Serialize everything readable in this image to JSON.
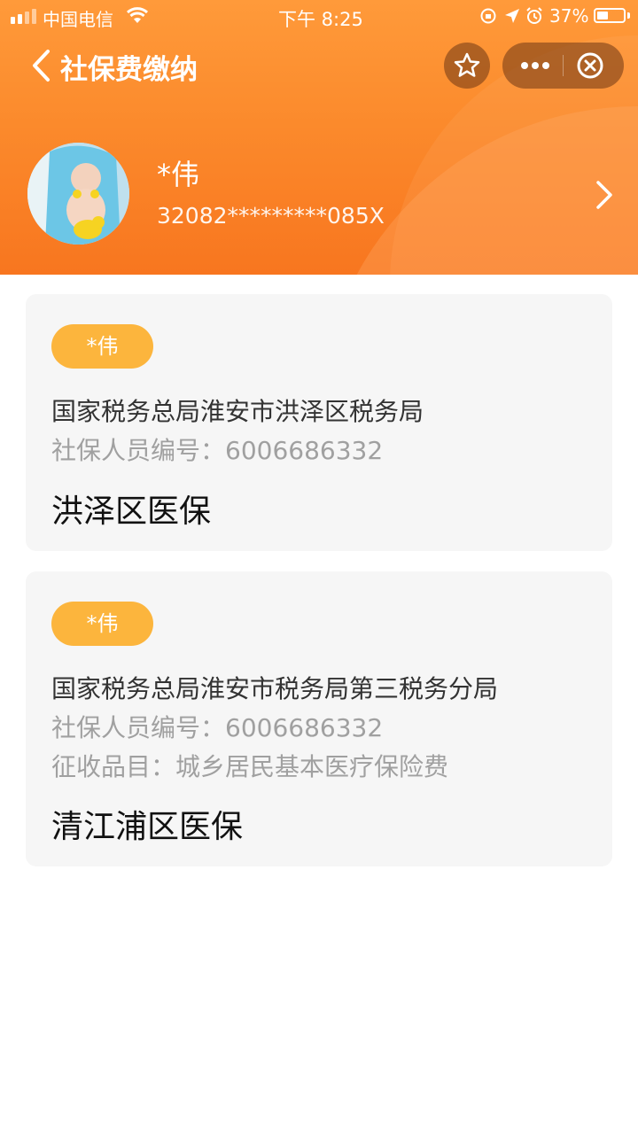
{
  "status_bar": {
    "carrier": "中国电信",
    "time": "下午 8:25",
    "battery": "37%"
  },
  "nav": {
    "title": "社保费缴纳",
    "back_icon": "chevron-left-icon",
    "favorite_icon": "star-icon",
    "more_icon": "more-dots-icon",
    "close_icon": "close-circle-icon"
  },
  "profile": {
    "name": "*伟",
    "id_number": "32082*********085X"
  },
  "cards": [
    {
      "tag": "*伟",
      "org": "国家税务总局淮安市洪泽区税务局",
      "member_id": "社保人员编号：6006686332",
      "title": "洪泽区医保"
    },
    {
      "tag": "*伟",
      "org": "国家税务总局淮安市税务局第三税务分局",
      "member_id": "社保人员编号：6006686332",
      "item": "征收品目：城乡居民基本医疗保险费",
      "title": "清江浦区医保"
    }
  ],
  "colors": {
    "header_orange": "#f8761f",
    "tag_yellow": "#fcb53d",
    "card_bg": "#f6f6f6"
  }
}
